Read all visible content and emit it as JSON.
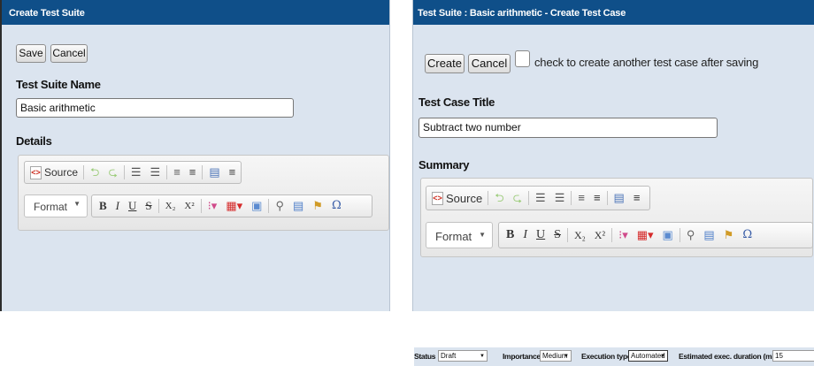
{
  "left": {
    "title": "Create Test Suite",
    "save_label": "Save",
    "cancel_label": "Cancel",
    "name_label": "Test Suite Name",
    "name_value": "Basic arithmetic",
    "details_label": "Details",
    "editor": {
      "source_label": "Source",
      "format_label": "Format"
    }
  },
  "right": {
    "title": "Test Suite : Basic arithmetic - Create Test Case",
    "create_label": "Create",
    "cancel_label": "Cancel",
    "checkbox_label": "check to create another test case after saving",
    "title_label": "Test Case Title",
    "title_value": "Subtract  two number",
    "summary_label": "Summary",
    "editor": {
      "source_label": "Source",
      "format_label": "Format"
    }
  },
  "status_bar": {
    "status_label": "Status",
    "status_value": "Draft",
    "importance_label": "Importance",
    "importance_value": "Medium",
    "exec_type_label": "Execution type",
    "exec_type_value": "Automated",
    "duration_label": "Estimated exec. duration (min)",
    "duration_value": "15"
  },
  "icons": {
    "source": "source-icon",
    "undo": "undo-icon",
    "redo": "redo-icon",
    "numbered_list": "numbered-list-icon",
    "bulleted_list": "bulleted-list-icon",
    "outdent": "outdent-icon",
    "indent": "indent-icon",
    "bold": "B",
    "italic": "I",
    "underline": "U",
    "strike": "S",
    "subscript": "X₂",
    "superscript": "X²",
    "omega": "Ω"
  },
  "colors": {
    "title_bar": "#0f4f89",
    "panel_bg": "#dbe4ef"
  }
}
